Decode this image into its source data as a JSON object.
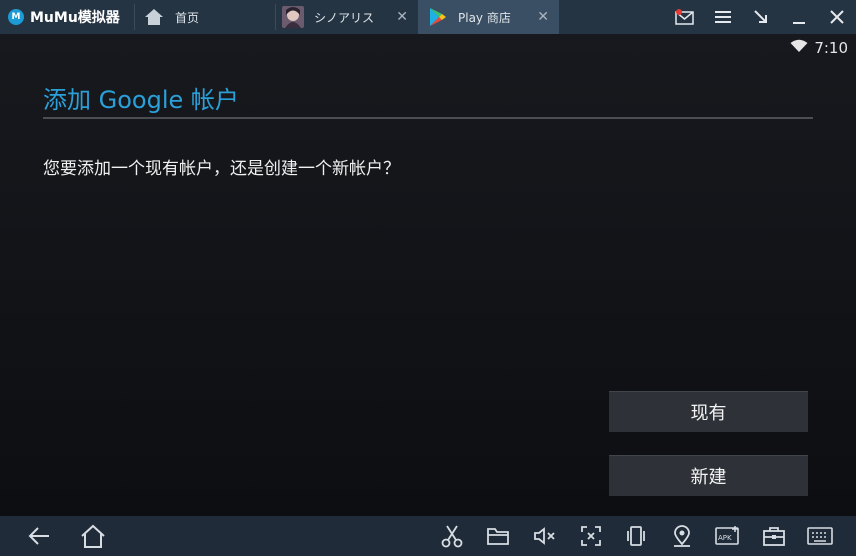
{
  "app": {
    "brand": "MuMu模拟器"
  },
  "tabs": [
    {
      "label": "首页",
      "icon": "home-icon",
      "closable": false
    },
    {
      "label": "シノアリス",
      "icon": "game-avatar-icon",
      "closable": true
    },
    {
      "label": "Play 商店",
      "icon": "play-store-icon",
      "closable": true,
      "active": true
    }
  ],
  "window_controls": [
    "mail-icon",
    "menu-icon",
    "shrink-icon",
    "minimize-icon",
    "close-icon"
  ],
  "status": {
    "time": "7:10",
    "wifi": "wifi-icon"
  },
  "dialog": {
    "title": "添加 Google 帐户",
    "message": "您要添加一个现有帐户，还是创建一个新帐户？",
    "existing_button": "现有",
    "new_button": "新建"
  },
  "navbar": {
    "left": [
      "back-icon",
      "home-icon"
    ],
    "right": [
      "scissors-icon",
      "folder-icon",
      "mute-icon",
      "fullscreen-icon",
      "rotate-icon",
      "location-icon",
      "apk-icon",
      "toolbox-icon",
      "keyboard-icon"
    ]
  },
  "colors": {
    "titlebar": "#253443",
    "accent": "#2ba0d8",
    "navbar": "#1f2b38"
  }
}
